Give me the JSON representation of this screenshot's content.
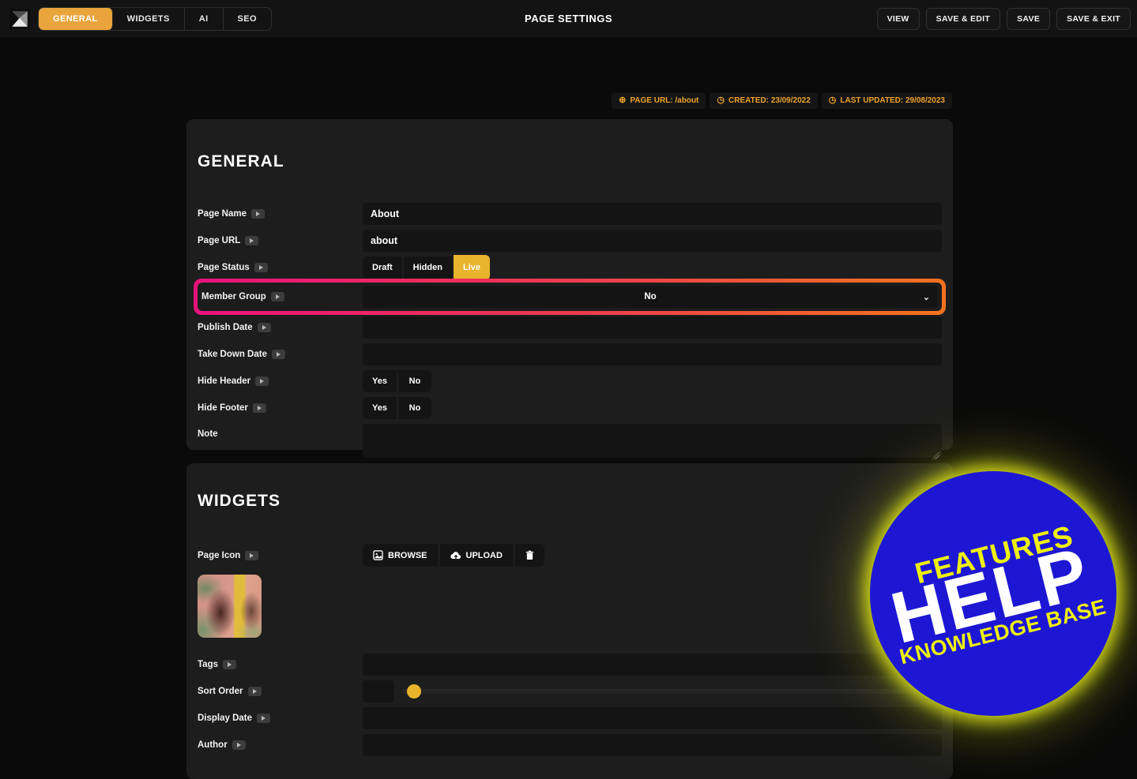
{
  "header": {
    "title": "PAGE SETTINGS",
    "tabs": [
      "GENERAL",
      "WIDGETS",
      "AI",
      "SEO"
    ],
    "active_tab": "GENERAL",
    "actions": [
      "VIEW",
      "SAVE & EDIT",
      "SAVE",
      "SAVE & EXIT"
    ]
  },
  "meta": {
    "page_url": "PAGE URL: /about",
    "created": "CREATED: 23/09/2022",
    "last_updated": "LAST UPDATED: 29/08/2023",
    "globe_glyph": "⊕",
    "clock_glyph": "◷"
  },
  "general": {
    "heading": "GENERAL",
    "page_name": {
      "label": "Page Name",
      "value": "About"
    },
    "page_url": {
      "label": "Page URL",
      "value": "about"
    },
    "page_status": {
      "label": "Page Status",
      "options": [
        "Draft",
        "Hidden",
        "Live"
      ],
      "selected": "Live"
    },
    "member_group": {
      "label": "Member Group",
      "value": "No",
      "chevron": "⌄"
    },
    "publish_date": {
      "label": "Publish Date",
      "value": ""
    },
    "take_down_date": {
      "label": "Take Down Date",
      "value": ""
    },
    "hide_header": {
      "label": "Hide Header",
      "options": [
        "Yes",
        "No"
      ]
    },
    "hide_footer": {
      "label": "Hide Footer",
      "options": [
        "Yes",
        "No"
      ]
    },
    "note": {
      "label": "Note",
      "value": ""
    }
  },
  "widgets": {
    "heading": "WIDGETS",
    "page_icon": {
      "label": "Page Icon",
      "browse_label": "BROWSE",
      "upload_label": "UPLOAD"
    },
    "tags": {
      "label": "Tags",
      "value": ""
    },
    "sort_order": {
      "label": "Sort Order",
      "value": ""
    },
    "display_date": {
      "label": "Display Date",
      "value": ""
    },
    "author": {
      "label": "Author",
      "value": ""
    }
  },
  "help_badge": {
    "line1": "FEATURES",
    "line2": "HELP",
    "line3": "KNOWLEDGE BASE"
  },
  "colors": {
    "accent_yellow": "#e9a43c",
    "accent_yellow_bright": "#eab32c",
    "badge_text": "#efa32c",
    "highlight_gradient_start": "#e7137c",
    "highlight_gradient_end": "#f5731d",
    "help_blue": "#1d17d4",
    "help_glow": "#dde619",
    "panel_bg": "#1d1d1d",
    "field_bg": "#141414",
    "page_bg": "#0a0a0a"
  }
}
